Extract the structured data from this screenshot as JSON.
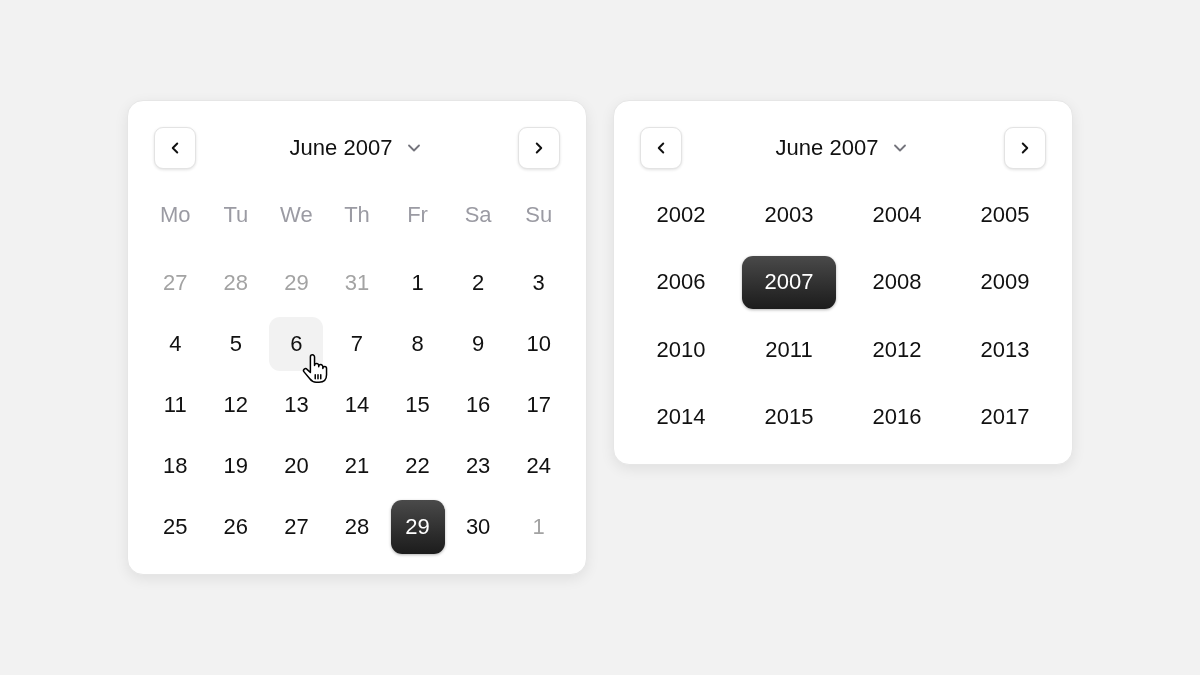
{
  "day_picker": {
    "title": "June 2007",
    "weekdays": [
      "Mo",
      "Tu",
      "We",
      "Th",
      "Fr",
      "Sa",
      "Su"
    ],
    "days": [
      {
        "label": "27",
        "outside_month": true,
        "selected": false,
        "hovered": false
      },
      {
        "label": "28",
        "outside_month": true,
        "selected": false,
        "hovered": false
      },
      {
        "label": "29",
        "outside_month": true,
        "selected": false,
        "hovered": false
      },
      {
        "label": "31",
        "outside_month": true,
        "selected": false,
        "hovered": false
      },
      {
        "label": "1",
        "outside_month": false,
        "selected": false,
        "hovered": false
      },
      {
        "label": "2",
        "outside_month": false,
        "selected": false,
        "hovered": false
      },
      {
        "label": "3",
        "outside_month": false,
        "selected": false,
        "hovered": false
      },
      {
        "label": "4",
        "outside_month": false,
        "selected": false,
        "hovered": false
      },
      {
        "label": "5",
        "outside_month": false,
        "selected": false,
        "hovered": false
      },
      {
        "label": "6",
        "outside_month": false,
        "selected": false,
        "hovered": true
      },
      {
        "label": "7",
        "outside_month": false,
        "selected": false,
        "hovered": false
      },
      {
        "label": "8",
        "outside_month": false,
        "selected": false,
        "hovered": false
      },
      {
        "label": "9",
        "outside_month": false,
        "selected": false,
        "hovered": false
      },
      {
        "label": "10",
        "outside_month": false,
        "selected": false,
        "hovered": false
      },
      {
        "label": "11",
        "outside_month": false,
        "selected": false,
        "hovered": false
      },
      {
        "label": "12",
        "outside_month": false,
        "selected": false,
        "hovered": false
      },
      {
        "label": "13",
        "outside_month": false,
        "selected": false,
        "hovered": false
      },
      {
        "label": "14",
        "outside_month": false,
        "selected": false,
        "hovered": false
      },
      {
        "label": "15",
        "outside_month": false,
        "selected": false,
        "hovered": false
      },
      {
        "label": "16",
        "outside_month": false,
        "selected": false,
        "hovered": false
      },
      {
        "label": "17",
        "outside_month": false,
        "selected": false,
        "hovered": false
      },
      {
        "label": "18",
        "outside_month": false,
        "selected": false,
        "hovered": false
      },
      {
        "label": "19",
        "outside_month": false,
        "selected": false,
        "hovered": false
      },
      {
        "label": "20",
        "outside_month": false,
        "selected": false,
        "hovered": false
      },
      {
        "label": "21",
        "outside_month": false,
        "selected": false,
        "hovered": false
      },
      {
        "label": "22",
        "outside_month": false,
        "selected": false,
        "hovered": false
      },
      {
        "label": "23",
        "outside_month": false,
        "selected": false,
        "hovered": false
      },
      {
        "label": "24",
        "outside_month": false,
        "selected": false,
        "hovered": false
      },
      {
        "label": "25",
        "outside_month": false,
        "selected": false,
        "hovered": false
      },
      {
        "label": "26",
        "outside_month": false,
        "selected": false,
        "hovered": false
      },
      {
        "label": "27",
        "outside_month": false,
        "selected": false,
        "hovered": false
      },
      {
        "label": "28",
        "outside_month": false,
        "selected": false,
        "hovered": false
      },
      {
        "label": "29",
        "outside_month": false,
        "selected": true,
        "hovered": false
      },
      {
        "label": "30",
        "outside_month": false,
        "selected": false,
        "hovered": false
      },
      {
        "label": "1",
        "outside_month": true,
        "selected": false,
        "hovered": false
      }
    ]
  },
  "year_picker": {
    "title": "June 2007",
    "years": [
      {
        "label": "2002",
        "selected": false
      },
      {
        "label": "2003",
        "selected": false
      },
      {
        "label": "2004",
        "selected": false
      },
      {
        "label": "2005",
        "selected": false
      },
      {
        "label": "2006",
        "selected": false
      },
      {
        "label": "2007",
        "selected": true
      },
      {
        "label": "2008",
        "selected": false
      },
      {
        "label": "2009",
        "selected": false
      },
      {
        "label": "2010",
        "selected": false
      },
      {
        "label": "2011",
        "selected": false
      },
      {
        "label": "2012",
        "selected": false
      },
      {
        "label": "2013",
        "selected": false
      },
      {
        "label": "2014",
        "selected": false
      },
      {
        "label": "2015",
        "selected": false
      },
      {
        "label": "2016",
        "selected": false
      },
      {
        "label": "2017",
        "selected": false
      }
    ]
  }
}
